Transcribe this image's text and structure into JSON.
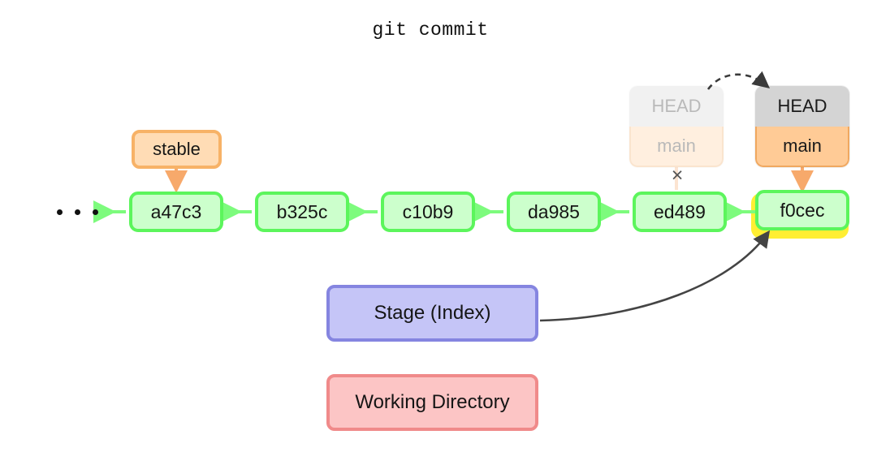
{
  "title": "git commit",
  "colors": {
    "background": "#ffffff",
    "commit_fill": "#ccffcc",
    "commit_border": "#5cf55c",
    "tag_fill": "#ffdcb5",
    "tag_border": "#f7b267",
    "head_fill": "#d4d4d4",
    "branch_fill": "#ffcb96",
    "branch_border": "#f0a860",
    "highlight": "#ffee33",
    "stage_fill": "#c5c5f7",
    "stage_border": "#8585e0",
    "working_fill": "#fcc5c5",
    "working_border": "#f08a8a",
    "arrow_dark": "#444444",
    "arrow_green": "#7dfb7d",
    "arrow_orange": "#f7a96b",
    "cross_mark": "#555555"
  },
  "commits": [
    {
      "id": "a47c3"
    },
    {
      "id": "b325c"
    },
    {
      "id": "c10b9"
    },
    {
      "id": "da985"
    },
    {
      "id": "ed489"
    },
    {
      "id": "f0cec",
      "highlighted": true
    }
  ],
  "ellipsis": {
    "label": "...",
    "dots": 3
  },
  "tags": [
    {
      "name": "stable",
      "points_to": "a47c3"
    }
  ],
  "refs": [
    {
      "state": "previous",
      "faded": true,
      "head_label": "HEAD",
      "branch_label": "main",
      "points_to": "ed489",
      "link_crossed_out": true,
      "cross_glyph": "×"
    },
    {
      "state": "current",
      "faded": false,
      "head_label": "HEAD",
      "branch_label": "main",
      "points_to": "f0cec",
      "link_crossed_out": false
    }
  ],
  "areas": [
    {
      "name": "stage",
      "label": "Stage (Index)"
    },
    {
      "name": "working-directory",
      "label": "Working Directory"
    }
  ],
  "arrows": [
    {
      "name": "move-head-arrow",
      "style": "dashed",
      "from": "previous-head",
      "to": "current-head"
    },
    {
      "name": "stage-to-commit-arrow",
      "style": "curved-solid",
      "from": "stage",
      "to": "f0cec"
    }
  ]
}
